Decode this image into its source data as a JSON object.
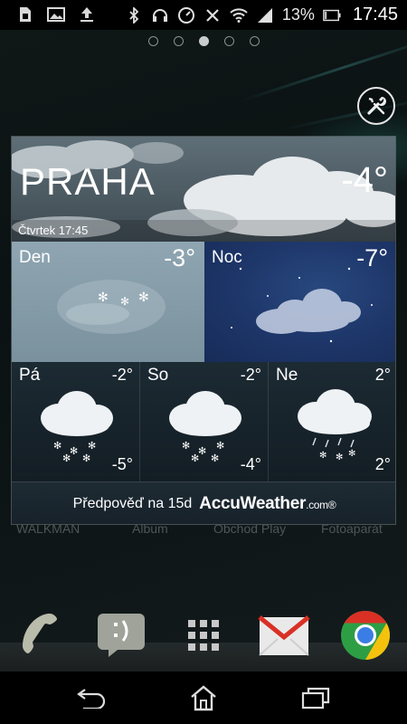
{
  "status_bar": {
    "notification_icons": [
      "sim-card-icon",
      "image-icon",
      "upload-icon"
    ],
    "system_icons": [
      "bluetooth-icon",
      "headset-icon",
      "gauge-icon",
      "nfc-icon",
      "wifi-icon",
      "signal-icon"
    ],
    "battery_percent": "13%",
    "battery_level": 0.13,
    "time": "17:45"
  },
  "pager": {
    "pages": 5,
    "active_index": 2
  },
  "weather": {
    "city": "PRAHA",
    "current_temp": "-4°",
    "date_time": "Čtvrtek 17:45",
    "day": {
      "label": "Den",
      "temp": "-3°"
    },
    "night": {
      "label": "Noc",
      "temp": "-7°"
    },
    "forecast": [
      {
        "day": "Pá",
        "high": "-2°",
        "low": "-5°",
        "icon": "snow-cloud-icon"
      },
      {
        "day": "So",
        "high": "-2°",
        "low": "-4°",
        "icon": "snow-cloud-icon"
      },
      {
        "day": "Ne",
        "high": "2°",
        "low": "2°",
        "icon": "rain-snow-cloud-icon"
      }
    ],
    "forecast_link": "Předpověď na 15d",
    "provider": "AccuWeather",
    "provider_suffix": ".com®"
  },
  "app_labels": [
    "WALKMAN",
    "Album",
    "Obchod Play",
    "Fotoaparát"
  ],
  "dock": [
    "phone-icon",
    "messaging-icon",
    "app-drawer-icon",
    "gmail-icon",
    "chrome-icon"
  ],
  "nav": [
    "back-icon",
    "home-icon",
    "recent-apps-icon"
  ],
  "colors": {
    "night_panel": "#1d3568",
    "day_panel": "#8fa6b2",
    "gmail_red": "#d93025"
  }
}
